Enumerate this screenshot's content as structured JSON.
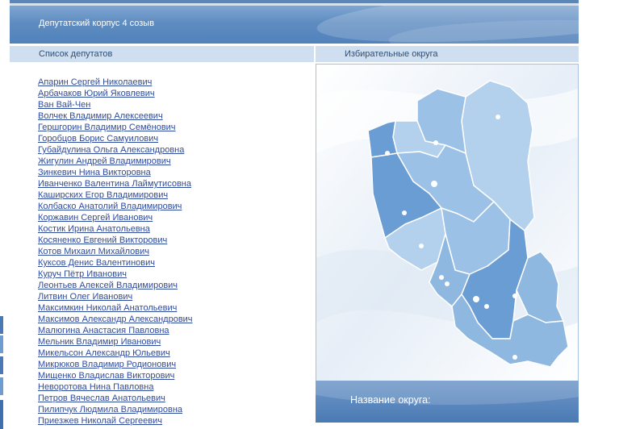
{
  "header": {
    "title": "Депутатский корпус 4 созыв"
  },
  "columns": {
    "deputies": "Список депутатов",
    "districts": "Избирательные округа"
  },
  "deputies": [
    "Апарин Сергей Николаевич",
    "Арбачаков Юрий Яковлевич",
    "Ван Вай-Чен",
    "Волчек Владимир Алексеевич",
    "Гершгорин Владимир Семёнович",
    "Горобцов Борис Самуилович",
    "Губайдулина Ольга Александровна",
    "Жигулин Андрей Владимирович",
    "Зинкевич Нина Викторовна",
    "Иванченко Валентина Лаймутисовна",
    "Каширских Егор Владимирович",
    "Колбаско Анатолий Владимирович",
    "Коржавин Сергей Иванович",
    "Костик Ирина Анатольевна",
    "Косяненко Евгений Викторович",
    "Котов Михаил Михайлович",
    "Куксов Денис Валентинович",
    "Куруч Пётр Иванович",
    "Леонтьев Алексей Владимирович",
    "Литвин Олег Иванович",
    "Максимкин Николай Анатольевич",
    "Максимов Александр Александрович",
    "Малюгина Анастасия Павловна",
    "Мельник Владимир Иванович",
    "Микельсон Александр Юльевич",
    "Микрюков Владимир Родионович",
    "Мищенко Владислав Викторович",
    "Неворотова Нина Павловна",
    "Петров Вячеслав Анатольевич",
    "Пилипчук Людмила Владимировна",
    "Приезжев Николай Сергеевич"
  ],
  "map": {
    "footer_label": "Название округа:"
  },
  "colors": {
    "header": "#5e8cc1",
    "subheader": "#cfdff0",
    "link": "#2f4b9c",
    "region_dark": "#6a9dd3",
    "region_mid": "#8fb8e0",
    "region_light": "#b3d0ec"
  }
}
